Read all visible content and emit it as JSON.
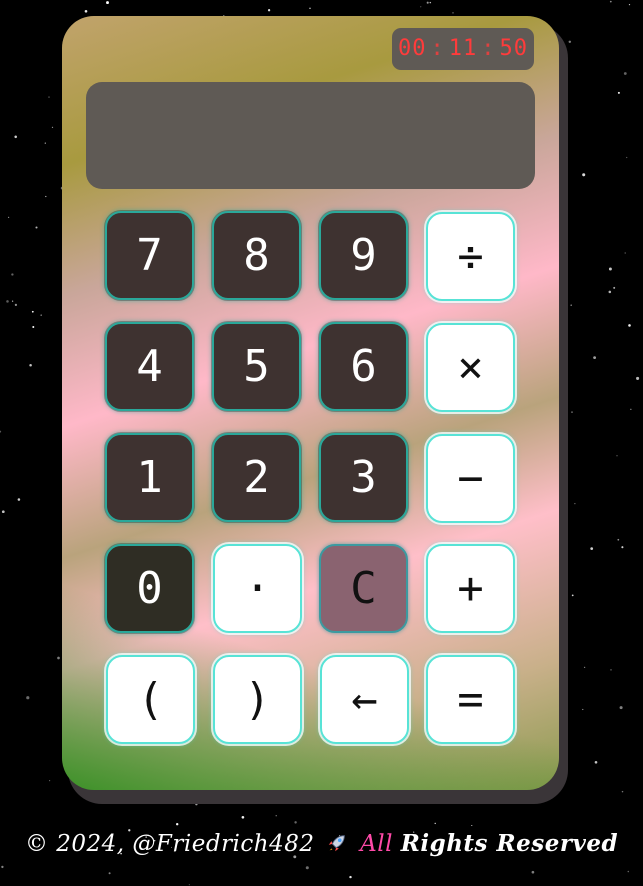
{
  "clock": {
    "hours": "00",
    "minutes": "11",
    "seconds": "50",
    "separator": ":"
  },
  "display": {
    "value": ""
  },
  "keys": {
    "seven": "7",
    "eight": "8",
    "nine": "9",
    "divide": "÷",
    "four": "4",
    "five": "5",
    "six": "6",
    "multiply": "×",
    "one": "1",
    "two": "2",
    "three": "3",
    "minus": "−",
    "zero": "0",
    "dot": "·",
    "clear": "C",
    "plus": "+",
    "open_paren": "(",
    "close_paren": ")",
    "backspace": "←",
    "equals": "="
  },
  "footer": {
    "copyright": "© 2024, @Friedrich482",
    "all": "All",
    "rights": "Rights Reserved"
  },
  "colors": {
    "dark_key": "#3e3230",
    "light_key": "#ffffff",
    "clear_key": "#8a6370",
    "key_border": "#58e3d6",
    "clock_text": "#ff3b3b",
    "panel": "#5f5a55"
  }
}
